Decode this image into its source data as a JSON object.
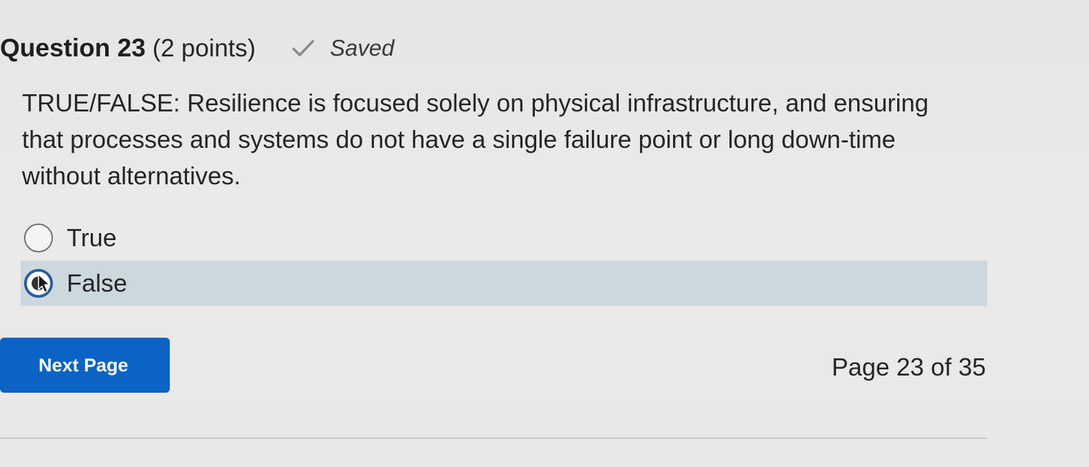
{
  "question": {
    "title": "Question 23",
    "points": "(2 points)",
    "status": "Saved",
    "status_icon": "checkmark-icon",
    "text": "TRUE/FALSE: Resilience is focused solely on physical infrastructure, and ensuring that processes and systems do not have a single failure point or long down-time without alternatives."
  },
  "options": [
    {
      "label": "True",
      "selected": false
    },
    {
      "label": "False",
      "selected": true
    }
  ],
  "navigation": {
    "next_label": "Next Page",
    "page_indicator": "Page 23 of 35"
  },
  "colors": {
    "primary_button": "#0b63c6",
    "selected_option_bg": "#cdd7de",
    "radio_checked_border": "#2a5d9e"
  }
}
